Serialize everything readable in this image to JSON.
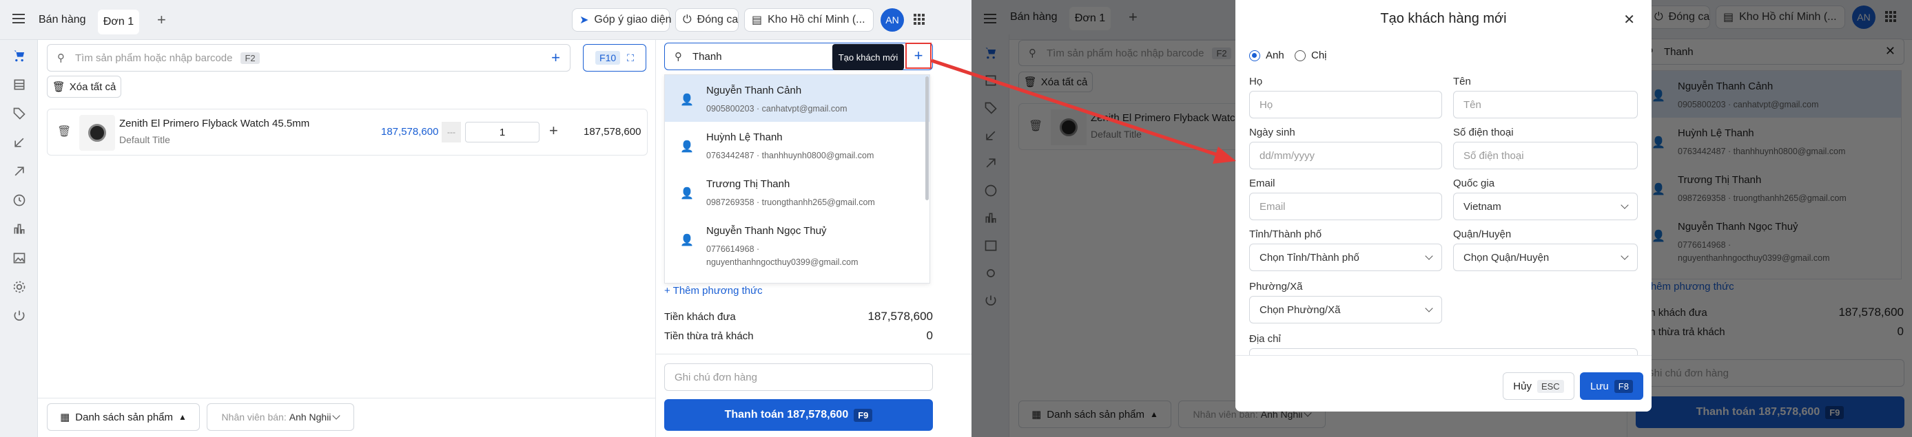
{
  "app": {
    "menu_label": "Bán hàng",
    "order_tab": "Đơn 1",
    "add_tab": "+",
    "feedback": "Góp ý giao diện",
    "close_shift": "Đóng ca",
    "warehouse": "Kho Hồ chí Minh (...",
    "avatar": "AN"
  },
  "product_search": {
    "placeholder": "Tìm sản phẩm hoặc nhập barcode",
    "shortcut": "F2",
    "f10": "F10"
  },
  "clear_all": "Xóa tất cả",
  "cart_item": {
    "name": "Zenith El Primero Flyback Watch 45.5mm",
    "variant": "Default Title",
    "price": "187,578,600",
    "discount": "---",
    "qty": "1",
    "total": "187,578,600"
  },
  "customer_search": {
    "value": "Thanh",
    "tooltip": "Tạo khách mới",
    "add": "+",
    "results": [
      {
        "name": "Nguyễn Thanh Cảnh",
        "sub": "0905800203 · canhatvpt@gmail.com"
      },
      {
        "name": "Huỳnh Lệ Thanh",
        "sub": "0763442487 · thanhhuynh0800@gmail.com"
      },
      {
        "name": "Trương Thị Thanh",
        "sub": "0987269358 · truongthanhh265@gmail.com"
      },
      {
        "name": "Nguyễn Thanh Ngọc Thuỷ",
        "sub": "0776614968 · nguyenthanhngocthuy0399@gmail.com"
      }
    ]
  },
  "payment": {
    "add_method": "+ Thêm phương thức",
    "paid_label": "Tiền khách đưa",
    "paid_value": "187,578,600",
    "change_label": "Tiền thừa trả khách",
    "change_value": "0",
    "note_placeholder": "Ghi chú đơn hàng",
    "checkout": "Thanh toán 187,578,600",
    "checkout_key": "F9"
  },
  "footer": {
    "product_list": "Danh sách sản phẩm",
    "staff_label": "Nhân viên bán:",
    "staff_name": "Anh Nghii"
  },
  "modal": {
    "title": "Tạo khách hàng mới",
    "gender_male": "Anh",
    "gender_female": "Chị",
    "last_name_label": "Họ",
    "last_name_ph": "Họ",
    "first_name_label": "Tên",
    "first_name_ph": "Tên",
    "dob_label": "Ngày sinh",
    "dob_ph": "dd/mm/yyyy",
    "phone_label": "Số điện thoại",
    "phone_ph": "Số điện thoại",
    "email_label": "Email",
    "email_ph": "Email",
    "country_label": "Quốc gia",
    "country_value": "Vietnam",
    "province_label": "Tỉnh/Thành phố",
    "province_value": "Chọn Tỉnh/Thành phố",
    "district_label": "Quận/Huyện",
    "district_value": "Chọn Quận/Huyện",
    "ward_label": "Phường/Xã",
    "ward_value": "Chọn Phường/Xã",
    "address_label": "Địa chỉ",
    "cancel": "Hủy",
    "cancel_key": "ESC",
    "save": "Lưu",
    "save_key": "F8"
  },
  "colors": {
    "accent": "#1a5fd4",
    "arrow": "#e53935",
    "selected_row": "#dde9f8"
  }
}
